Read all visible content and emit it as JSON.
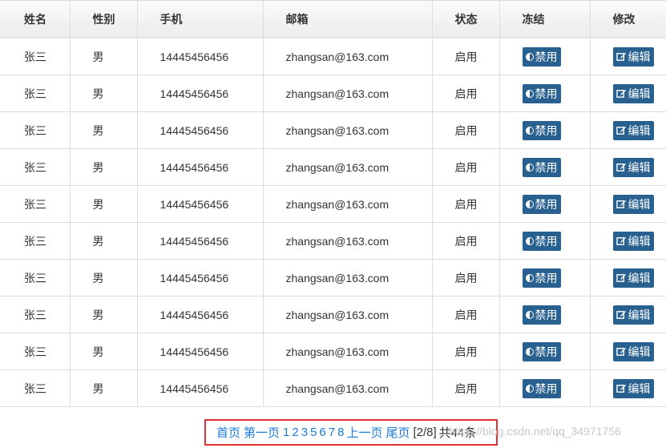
{
  "table": {
    "headers": [
      "姓名",
      "性别",
      "手机",
      "邮箱",
      "状态",
      "冻结",
      "修改"
    ],
    "rows": [
      {
        "name": "张三",
        "sex": "男",
        "phone": "14445456456",
        "email": "zhangsan@163.com",
        "status": "启用",
        "freeze": "禁用",
        "edit": "编辑"
      },
      {
        "name": "张三",
        "sex": "男",
        "phone": "14445456456",
        "email": "zhangsan@163.com",
        "status": "启用",
        "freeze": "禁用",
        "edit": "编辑"
      },
      {
        "name": "张三",
        "sex": "男",
        "phone": "14445456456",
        "email": "zhangsan@163.com",
        "status": "启用",
        "freeze": "禁用",
        "edit": "编辑"
      },
      {
        "name": "张三",
        "sex": "男",
        "phone": "14445456456",
        "email": "zhangsan@163.com",
        "status": "启用",
        "freeze": "禁用",
        "edit": "编辑"
      },
      {
        "name": "张三",
        "sex": "男",
        "phone": "14445456456",
        "email": "zhangsan@163.com",
        "status": "启用",
        "freeze": "禁用",
        "edit": "编辑"
      },
      {
        "name": "张三",
        "sex": "男",
        "phone": "14445456456",
        "email": "zhangsan@163.com",
        "status": "启用",
        "freeze": "禁用",
        "edit": "编辑"
      },
      {
        "name": "张三",
        "sex": "男",
        "phone": "14445456456",
        "email": "zhangsan@163.com",
        "status": "启用",
        "freeze": "禁用",
        "edit": "编辑"
      },
      {
        "name": "张三",
        "sex": "男",
        "phone": "14445456456",
        "email": "zhangsan@163.com",
        "status": "启用",
        "freeze": "禁用",
        "edit": "编辑"
      },
      {
        "name": "张三",
        "sex": "男",
        "phone": "14445456456",
        "email": "zhangsan@163.com",
        "status": "启用",
        "freeze": "禁用",
        "edit": "编辑"
      },
      {
        "name": "张三",
        "sex": "男",
        "phone": "14445456456",
        "email": "zhangsan@163.com",
        "status": "启用",
        "freeze": "禁用",
        "edit": "编辑"
      }
    ]
  },
  "pagination": {
    "first": "首页",
    "page_one": "第一页",
    "pages": [
      "1",
      "2",
      "3",
      "5",
      "6",
      "7",
      "8"
    ],
    "prev": "上一页",
    "last": "尾页",
    "current_info": "[2/8]",
    "total": "共44条"
  },
  "watermark": "https://blog.csdn.net/qq_34971756",
  "colors": {
    "button_bg": "#286090",
    "link": "#1a7bd8",
    "highlight_border": "#e03030"
  },
  "icons": {
    "freeze": "half-circle-icon",
    "edit": "edit-icon"
  }
}
